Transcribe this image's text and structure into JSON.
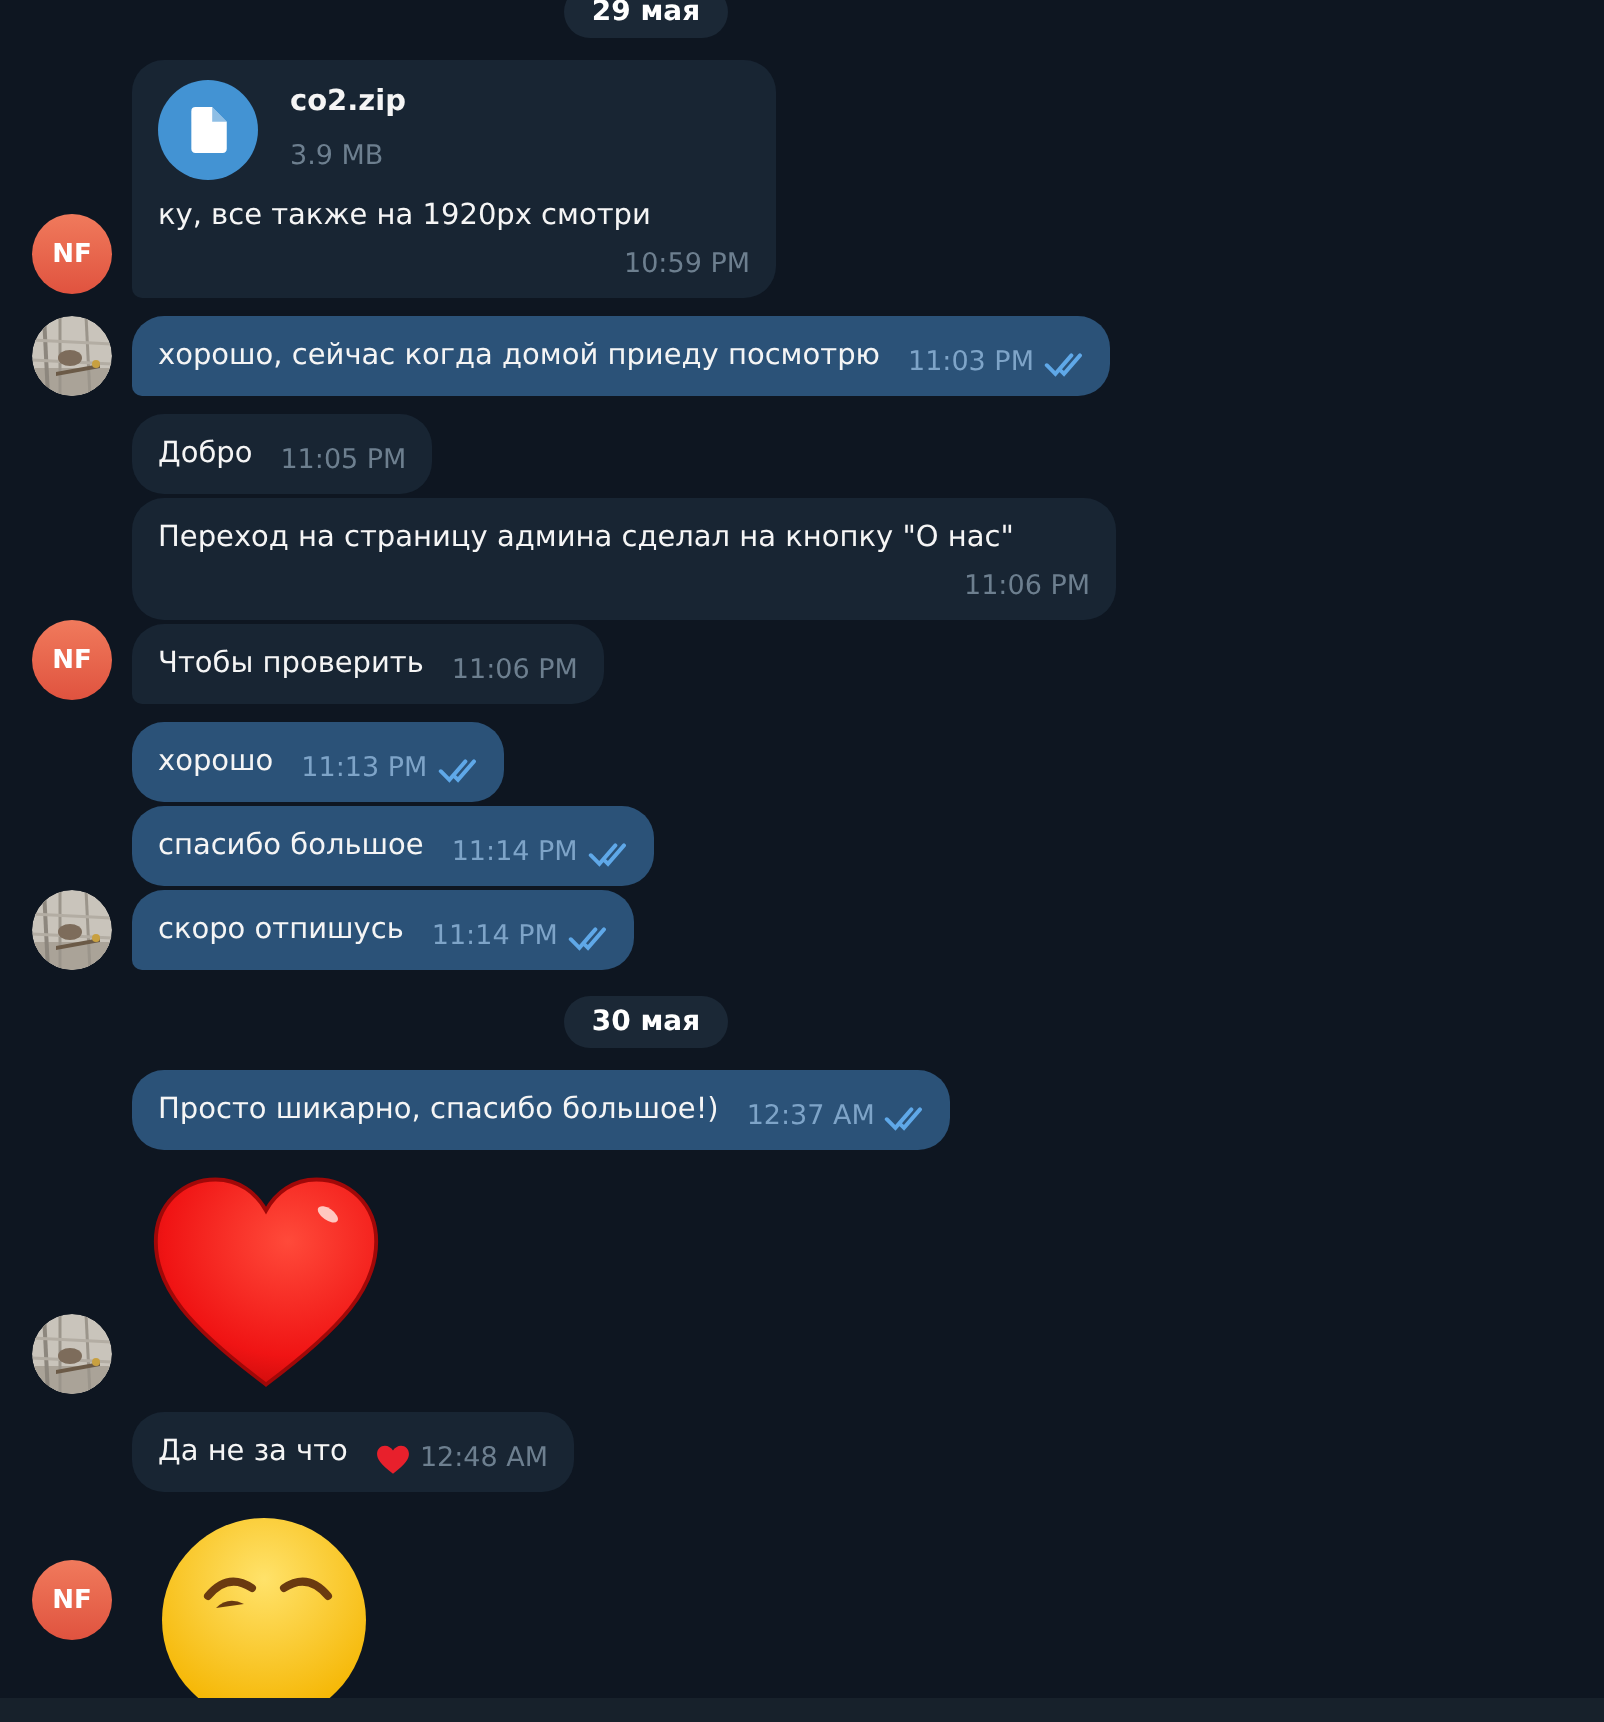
{
  "chat": [
    {
      "kind": "date",
      "label": "29 мая"
    },
    {
      "kind": "group",
      "outgoing": false,
      "avatar": {
        "kind": "initials",
        "initials": "NF"
      },
      "messages": [
        {
          "kind": "file",
          "file_name": "co2.zip",
          "file_size": "3.9 MB",
          "text": "ку, все также на 1920px смотри",
          "time": "10:59 PM"
        }
      ]
    },
    {
      "kind": "group",
      "outgoing": true,
      "avatar": {
        "kind": "picture"
      },
      "messages": [
        {
          "kind": "text",
          "text": "хорошо, сейчас когда домой приеду посмотрю",
          "time": "11:03 PM",
          "read": true
        }
      ]
    },
    {
      "kind": "group",
      "outgoing": false,
      "avatar": {
        "kind": "initials",
        "initials": "NF"
      },
      "messages": [
        {
          "kind": "text",
          "text": "Добро",
          "time": "11:05 PM"
        },
        {
          "kind": "text",
          "text": "Переход на страницу админа сделал на кнопку \"О нас\"",
          "time": "11:06 PM"
        },
        {
          "kind": "text",
          "text": "Чтобы проверить",
          "time": "11:06 PM"
        }
      ]
    },
    {
      "kind": "group",
      "outgoing": true,
      "avatar": {
        "kind": "picture"
      },
      "messages": [
        {
          "kind": "text",
          "text": "хорошо",
          "time": "11:13 PM",
          "read": true
        },
        {
          "kind": "text",
          "text": "спасибо большое",
          "time": "11:14 PM",
          "read": true
        },
        {
          "kind": "text",
          "text": "скоро отпишусь",
          "time": "11:14 PM",
          "read": true
        }
      ]
    },
    {
      "kind": "date",
      "label": "30 мая"
    },
    {
      "kind": "group",
      "outgoing": true,
      "avatar": {
        "kind": "picture"
      },
      "messages": [
        {
          "kind": "text",
          "text": "Просто шикарно, спасибо большое!)",
          "time": "12:37 AM",
          "read": true
        },
        {
          "kind": "heart"
        }
      ]
    },
    {
      "kind": "group",
      "outgoing": false,
      "avatar": {
        "kind": "initials",
        "initials": "NF"
      },
      "messages": [
        {
          "kind": "text",
          "text": "Да не за что",
          "time": "12:48 AM",
          "reaction": true
        },
        {
          "kind": "smiley"
        }
      ]
    }
  ]
}
